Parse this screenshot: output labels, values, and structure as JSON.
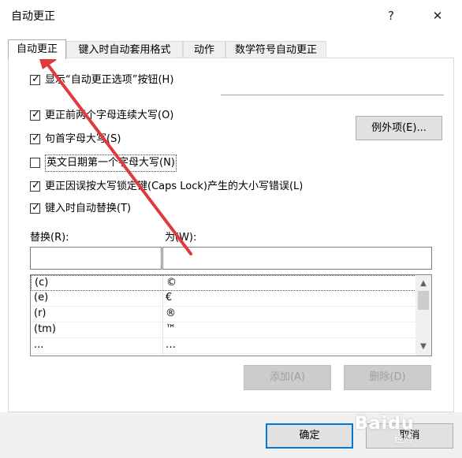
{
  "window": {
    "title": "自动更正",
    "help_symbol": "?",
    "close_symbol": "✕"
  },
  "tabs": [
    {
      "label": "自动更正",
      "active": true
    },
    {
      "label": "键入时自动套用格式",
      "active": false
    },
    {
      "label": "动作",
      "active": false
    },
    {
      "label": "数学符号自动更正",
      "active": false
    }
  ],
  "options": {
    "show_buttons": {
      "label": "显示“自动更正选项”按钮(H)",
      "checked": true
    },
    "two_initial_caps": {
      "label": "更正前两个字母连续大写(O)",
      "checked": true
    },
    "capitalize_sentence": {
      "label": "句首字母大写(S)",
      "checked": true
    },
    "capitalize_days": {
      "label": "英文日期第一个字母大写(N)",
      "checked": false
    },
    "caps_lock": {
      "label": "更正因误按大写锁定键(Caps Lock)产生的大小写错误(L)",
      "checked": true
    },
    "replace_as_type": {
      "label": "键入时自动替换(T)",
      "checked": true
    }
  },
  "check_mark": "✓",
  "exceptions_button": "例外项(E)...",
  "replace": {
    "label": "替换(R):",
    "value": ""
  },
  "with": {
    "label": "为(W):",
    "value": ""
  },
  "entries": [
    {
      "from": "(c)",
      "to": "©"
    },
    {
      "from": "(e)",
      "to": "€"
    },
    {
      "from": "(r)",
      "to": "®"
    },
    {
      "from": "(tm)",
      "to": "™"
    },
    {
      "from": "...",
      "to": "…"
    }
  ],
  "scroll": {
    "up": "▲",
    "down": "▼"
  },
  "add_button": "添加(A)",
  "delete_button": "删除(D)",
  "ok_button": "确定",
  "cancel_button": "取消",
  "watermark": {
    "text": "Baidu",
    "sub": "经验"
  },
  "accent_color": "#0078d7",
  "annotation_color": "#e0393e"
}
